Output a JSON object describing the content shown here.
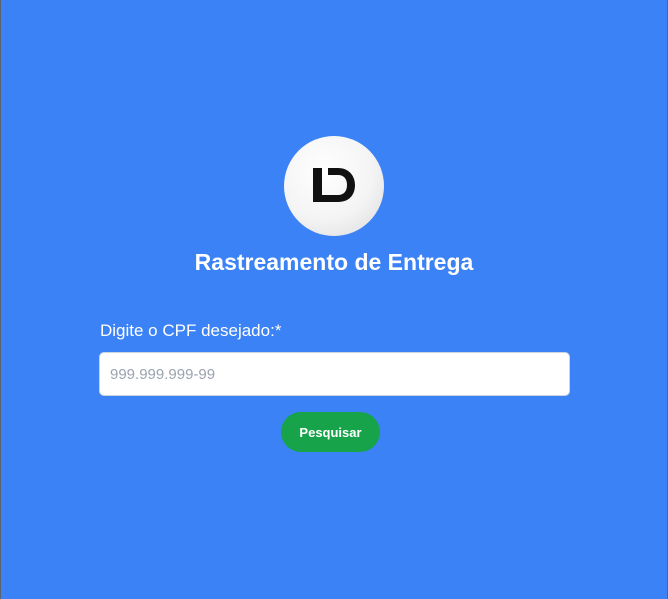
{
  "logo": {
    "text": "LD",
    "icon": "ld-logo-icon"
  },
  "page": {
    "title": "Rastreamento de Entrega"
  },
  "form": {
    "cpf_label": "Digite o CPF desejado:*",
    "cpf_placeholder": "999.999.999-99",
    "cpf_value": "",
    "search_label": "Pesquisar"
  },
  "colors": {
    "background": "#3b82f6",
    "button": "#16a34a",
    "text": "#ffffff"
  }
}
